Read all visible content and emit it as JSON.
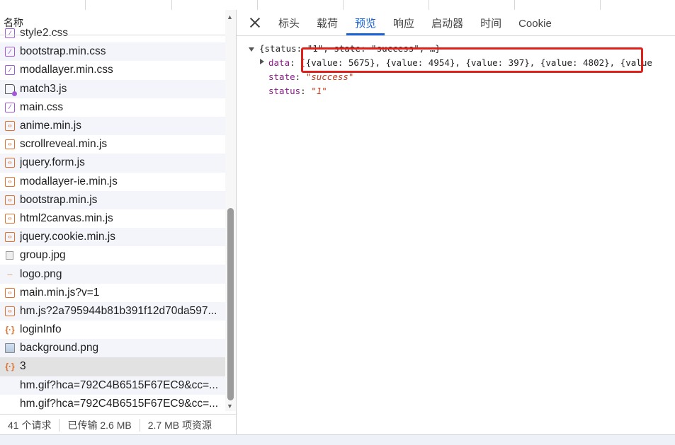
{
  "left_panel": {
    "name_header": "名称",
    "files": [
      {
        "name": "style2.css",
        "type": "css"
      },
      {
        "name": "bootstrap.min.css",
        "type": "css"
      },
      {
        "name": "modallayer.min.css",
        "type": "css"
      },
      {
        "name": "match3.js",
        "type": "doc"
      },
      {
        "name": "main.css",
        "type": "css"
      },
      {
        "name": "anime.min.js",
        "type": "js"
      },
      {
        "name": "scrollreveal.min.js",
        "type": "js"
      },
      {
        "name": "jquery.form.js",
        "type": "js"
      },
      {
        "name": "modallayer-ie.min.js",
        "type": "js"
      },
      {
        "name": "bootstrap.min.js",
        "type": "js"
      },
      {
        "name": "html2canvas.min.js",
        "type": "js"
      },
      {
        "name": "jquery.cookie.min.js",
        "type": "js"
      },
      {
        "name": "group.jpg",
        "type": "imgsmall"
      },
      {
        "name": "logo.png",
        "type": "blank"
      },
      {
        "name": "main.min.js?v=1",
        "type": "js"
      },
      {
        "name": "hm.js?2a795944b81b391f12d70da597...",
        "type": "js"
      },
      {
        "name": "loginInfo",
        "type": "json"
      },
      {
        "name": "background.png",
        "type": "img"
      },
      {
        "name": "3",
        "type": "json"
      },
      {
        "name": "hm.gif?hca=792C4B6515F67EC9&cc=...",
        "type": "none"
      },
      {
        "name": "hm.gif?hca=792C4B6515F67EC9&cc=...",
        "type": "none"
      }
    ],
    "selected_index": 18,
    "status": {
      "requests": "41 个请求",
      "transferred": "已传输 2.6 MB",
      "resources": "2.7 MB 项资源"
    }
  },
  "right_panel": {
    "tabs": [
      "标头",
      "载荷",
      "预览",
      "响应",
      "启动器",
      "时间",
      "Cookie"
    ],
    "active_tab": "预览",
    "preview": {
      "root_summary": "{status: \"1\", state: \"success\", …}",
      "data_key": "data",
      "data_value": "[{value: 5675}, {value: 4954}, {value: 397}, {value: 4802}, {value",
      "state_key": "state",
      "state_value": "\"success\"",
      "status_key": "status",
      "status_value": "\"1\""
    }
  },
  "colors": {
    "accent": "#1a64d6",
    "highlight_border": "#e0201a",
    "selected_row": "#e2e2e2"
  }
}
